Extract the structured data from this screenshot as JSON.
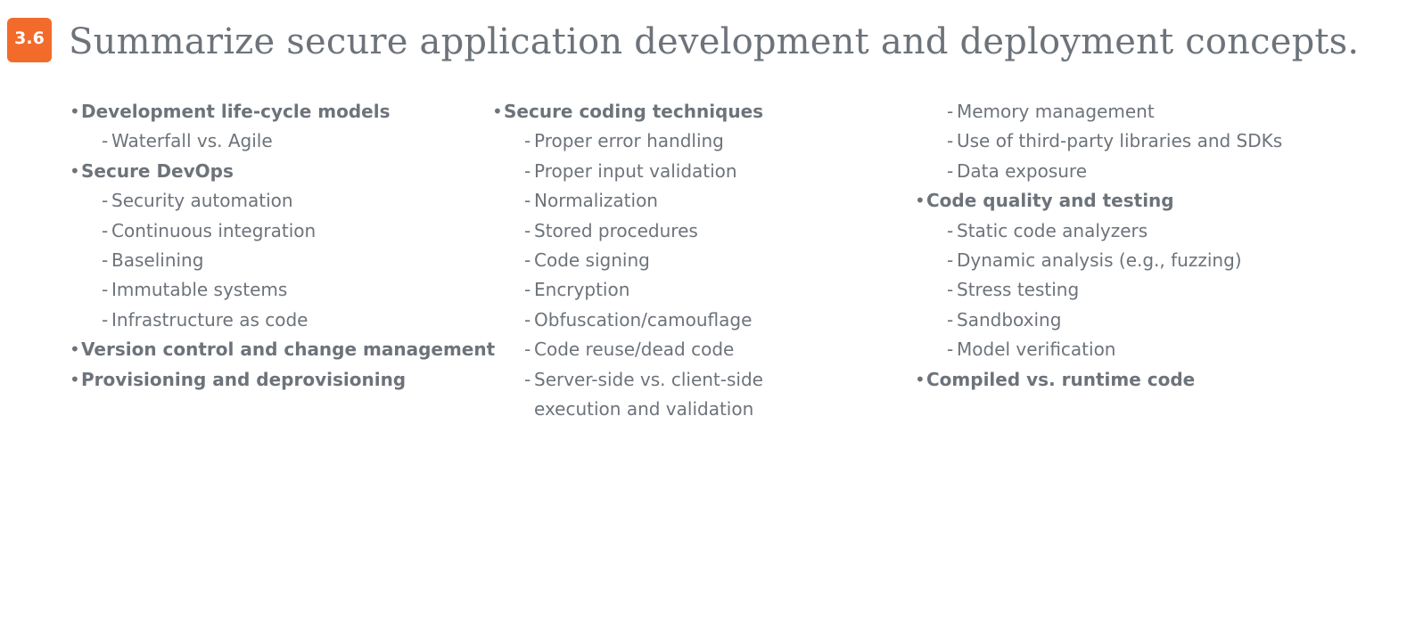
{
  "badge": "3.6",
  "title": "Summarize secure application development and deployment concepts.",
  "columns": [
    {
      "items": [
        {
          "type": "head",
          "text": "Development life-cycle models"
        },
        {
          "type": "sub",
          "text": "Waterfall vs. Agile"
        },
        {
          "type": "head",
          "text": "Secure DevOps"
        },
        {
          "type": "sub",
          "text": "Security automation"
        },
        {
          "type": "sub",
          "text": "Continuous integration"
        },
        {
          "type": "sub",
          "text": "Baselining"
        },
        {
          "type": "sub",
          "text": "Immutable systems"
        },
        {
          "type": "sub",
          "text": "Infrastructure as code"
        },
        {
          "type": "head",
          "text": "Version control and change management"
        },
        {
          "type": "head",
          "text": "Provisioning and deprovisioning"
        }
      ]
    },
    {
      "items": [
        {
          "type": "head",
          "text": "Secure coding techniques"
        },
        {
          "type": "sub",
          "text": "Proper error handling"
        },
        {
          "type": "sub",
          "text": "Proper input validation"
        },
        {
          "type": "sub",
          "text": "Normalization"
        },
        {
          "type": "sub",
          "text": "Stored procedures"
        },
        {
          "type": "sub",
          "text": "Code signing"
        },
        {
          "type": "sub",
          "text": "Encryption"
        },
        {
          "type": "sub",
          "text": "Obfuscation/camouflage"
        },
        {
          "type": "sub",
          "text": "Code reuse/dead code"
        },
        {
          "type": "sub",
          "text": "Server-side vs. client-side"
        },
        {
          "type": "cont",
          "text": "execution and validation"
        }
      ]
    },
    {
      "items": [
        {
          "type": "sub",
          "text": "Memory management"
        },
        {
          "type": "sub",
          "text": "Use of third-party libraries and SDKs"
        },
        {
          "type": "sub",
          "text": "Data exposure"
        },
        {
          "type": "head",
          "text": "Code quality and testing"
        },
        {
          "type": "sub",
          "text": "Static code analyzers"
        },
        {
          "type": "sub",
          "text": "Dynamic analysis (e.g., fuzzing)"
        },
        {
          "type": "sub",
          "text": "Stress testing"
        },
        {
          "type": "sub",
          "text": "Sandboxing"
        },
        {
          "type": "sub",
          "text": "Model verification"
        },
        {
          "type": "head",
          "text": "Compiled vs. runtime code"
        }
      ]
    }
  ]
}
